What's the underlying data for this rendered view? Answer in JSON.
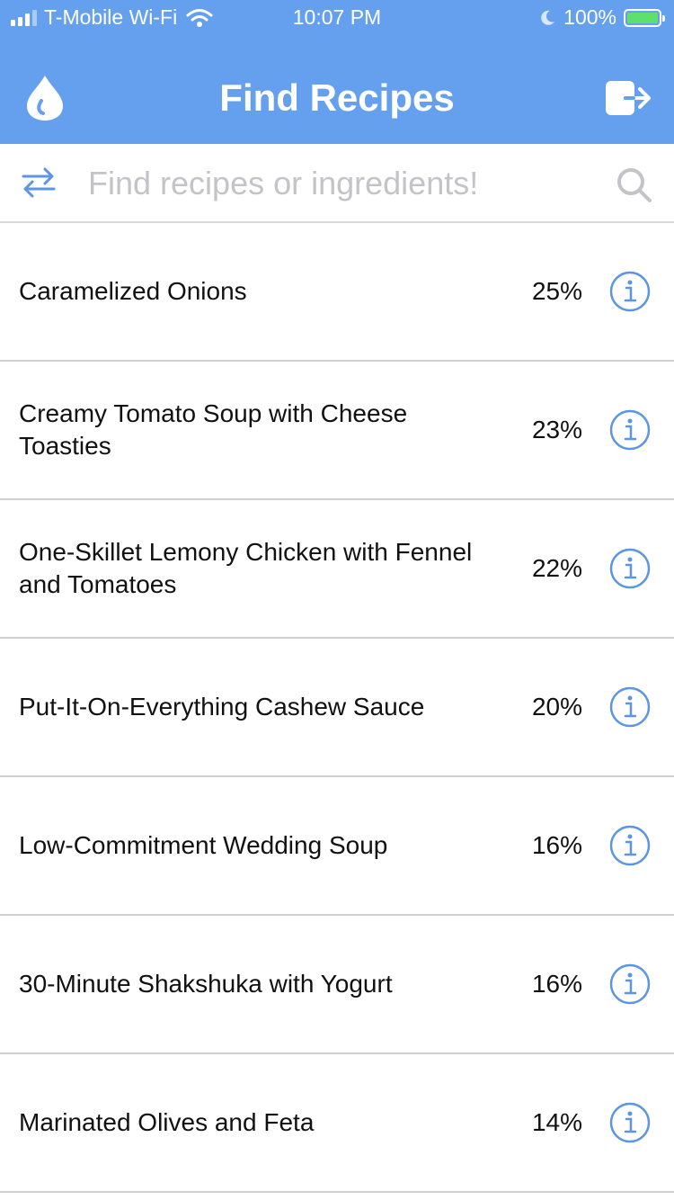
{
  "status_bar": {
    "carrier": "T-Mobile Wi-Fi",
    "time": "10:07 PM",
    "battery": "100%"
  },
  "header": {
    "title": "Find Recipes",
    "left_icon": "flame-drop-icon",
    "right_icon": "logout-icon",
    "background": "#65a0ef"
  },
  "search": {
    "placeholder": "Find recipes or ingredients!",
    "value": "",
    "swap_icon": "swap-arrows-icon",
    "search_icon": "search-icon"
  },
  "recipes": [
    {
      "title": "Caramelized Onions",
      "match": "25%"
    },
    {
      "title": "Creamy Tomato Soup with Cheese Toasties",
      "match": "23%"
    },
    {
      "title": "One-Skillet Lemony Chicken with Fennel and Tomatoes",
      "match": "22%"
    },
    {
      "title": "Put-It-On-Everything Cashew Sauce",
      "match": "20%"
    },
    {
      "title": "Low-Commitment Wedding Soup",
      "match": "16%"
    },
    {
      "title": "30-Minute Shakshuka with Yogurt",
      "match": "16%"
    },
    {
      "title": "Marinated Olives and Feta",
      "match": "14%"
    }
  ],
  "colors": {
    "accent": "#65a0ef",
    "icon_blue": "#5b95e3",
    "divider": "#d0d0d4"
  }
}
